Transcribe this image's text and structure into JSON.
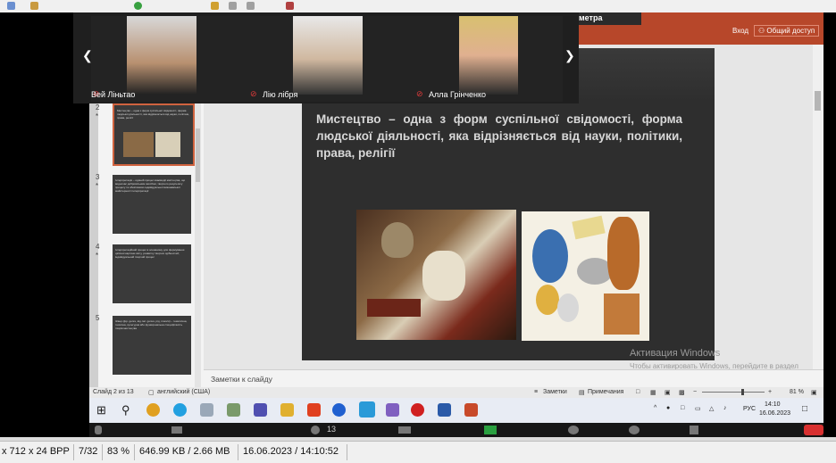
{
  "zoom": {
    "participants": [
      {
        "name": "Вей Ліньтао"
      },
      {
        "name": "Лію лібря"
      },
      {
        "name": "Алла Грінченко"
      }
    ],
    "bottom_count": "13"
  },
  "ppt": {
    "ribbon_tab": "метра",
    "login": "Вход",
    "share": "Общий доступ",
    "slide_numbers": [
      "2",
      "3",
      "4",
      "5"
    ],
    "slide_title": "Мистецтво – одна з форм суспільної свідомості, форма людської діяльності, яка відрізняється від науки, політики, права, релігії",
    "notes_placeholder": "Заметки к слайду",
    "status": {
      "slide_of": "Слайд 2 из 13",
      "language": "английский (США)",
      "notes_btn": "Заметки",
      "comments_btn": "Примечания",
      "zoom": "81 %"
    },
    "watermark": {
      "title": "Активация Windows",
      "text": "Чтобы активировать Windows, перейдите в раздел \"Параметры\"."
    },
    "thumb_texts": [
      "Мистецтво – одна з форм суспільної свідомості, форма людської діяльності, яка відрізняється від науки, політики, права, релігії",
      "Інтерпретація – одиний процес взаємодії мистецтва, що водночас добровільним засобом, творчого результату процесу та обов'язково індивідуальної виконавської майстерності інтерпретації",
      "Інтерпретаційний процес в основному для формування цілісної картини світу, розвитку творчих здібностей; індивідуальний творчий процес",
      "Жанр (фр. genre, від лат. genus, рід, плем'я) – тематична, технічна, культурна або функціональна специфічність творів мистецтва"
    ]
  },
  "taskbar": {
    "lang": "РУС",
    "time": "14:10",
    "date": "16.06.2023"
  },
  "viewer": {
    "dims": "x 712 x 24 BPP",
    "index": "7/32",
    "zoom": "83 %",
    "size": "646.99 KB / 2.66 MB",
    "datetime": "16.06.2023 / 14:10:52"
  },
  "colors": {
    "ribbon": "#b7472a",
    "slide_bg": "#2e2e2e",
    "accent_mic": "#e23b3b"
  }
}
